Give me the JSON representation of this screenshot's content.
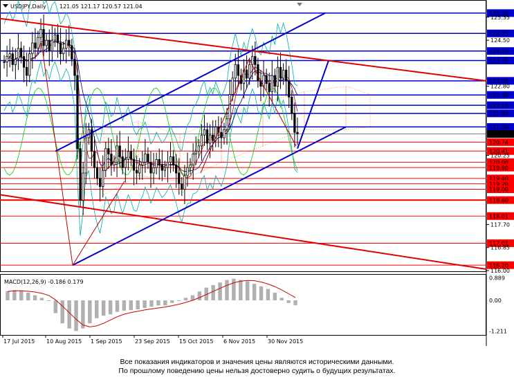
{
  "header": {
    "symbol": "USDJPY,Daily",
    "ohlc": "121.05 121.17 120.57 121.04"
  },
  "macd": {
    "label": "MACD(12,26,9) -0.186 0.179",
    "ticks": [
      "0.889",
      "0.00",
      "-1.211"
    ],
    "ylim": [
      -1.3,
      0.95
    ]
  },
  "disclaimer": {
    "line1": "Все показания индикаторов и значения цены являются историческими данными.",
    "line2": "По прошлому поведению цены нельзя достоверно судить о будущих результатах."
  },
  "colors": {
    "level_line": "#ff0000",
    "level_label_bg": "#ff0000",
    "key_level_bg": "#0000cc",
    "channel_red": "#e00000",
    "channel_blue": "#0000cc",
    "candles": "#000000",
    "bands": "#00aaaa",
    "ichimoku_cloud": "#ff9966",
    "rsi_line": "#00cc00",
    "macd_hist": "#b0b0b0",
    "macd_signal": "#cc0000"
  },
  "chart_data": {
    "type": "candlestick",
    "symbol": "USDJPY",
    "timeframe": "Daily",
    "ylim": [
      116.0,
      125.6
    ],
    "x_labels": [
      "17 Jul 2015",
      "10 Aug 2015",
      "1 Sep 2015",
      "23 Sep 2015",
      "15 Oct 2015",
      "6 Nov 2015",
      "30 Nov 2015"
    ],
    "price_ticks": [
      "125.50",
      "125.35",
      "124.75",
      "124.50",
      "124.10",
      "123.75",
      "123.00",
      "122.80",
      "122.48",
      "122.10",
      "121.80",
      "121.30",
      "121.04",
      "120.74",
      "120.41",
      "120.25",
      "120.00",
      "119.80",
      "119.40",
      "119.20",
      "119.00",
      "118.60",
      "118.01",
      "117.70",
      "117.01",
      "116.85",
      "116.20",
      "116.00"
    ],
    "levels": [
      {
        "price": "125.50",
        "style": "key"
      },
      {
        "price": "124.75",
        "style": "key"
      },
      {
        "price": "124.10",
        "style": "key"
      },
      {
        "price": "123.75",
        "style": "key"
      },
      {
        "price": "123.00",
        "style": "key"
      },
      {
        "price": "122.48",
        "style": "key"
      },
      {
        "price": "122.10",
        "style": "key"
      },
      {
        "price": "121.80",
        "style": "key"
      },
      {
        "price": "121.30",
        "style": "key"
      },
      {
        "price": "121.04",
        "style": "current"
      },
      {
        "price": "120.74",
        "style": "support"
      },
      {
        "price": "120.41",
        "style": "support"
      },
      {
        "price": "120.00",
        "style": "support"
      },
      {
        "price": "119.80",
        "style": "support"
      },
      {
        "price": "119.40",
        "style": "support"
      },
      {
        "price": "119.20",
        "style": "support"
      },
      {
        "price": "119.00",
        "style": "support"
      },
      {
        "price": "118.60",
        "style": "support"
      },
      {
        "price": "118.01",
        "style": "line"
      },
      {
        "price": "117.01",
        "style": "line"
      },
      {
        "price": "116.20",
        "style": "line"
      }
    ],
    "series": [
      {
        "close": [
          123.7,
          123.9,
          124.0,
          123.6,
          123.8,
          124.2,
          123.9,
          123.5,
          123.2,
          124.0,
          124.4,
          124.2,
          124.6,
          124.9,
          124.3,
          124.5,
          124.1,
          124.5,
          124.7,
          124.4,
          124.0,
          124.2,
          124.5,
          124.3,
          123.8,
          123.2,
          120.5,
          118.6,
          119.6,
          120.9,
          121.2,
          120.4,
          119.8,
          119.4,
          119.1,
          119.7,
          120.5,
          120.3,
          119.9,
          120.0,
          120.6,
          120.2,
          119.8,
          120.1,
          120.4,
          120.1,
          119.7,
          119.6,
          119.9,
          120.0,
          120.3,
          120.0,
          119.6,
          119.8,
          120.1,
          119.9,
          119.7,
          119.8,
          120.0,
          120.2,
          119.9,
          119.6,
          119.2,
          119.0,
          119.5,
          119.8,
          119.9,
          120.3,
          120.4,
          120.6,
          121.0,
          121.2,
          120.7,
          121.0,
          120.8,
          121.3,
          121.1,
          120.9,
          121.2,
          121.6,
          122.5,
          123.1,
          123.6,
          123.2,
          122.9,
          123.4,
          123.1,
          123.6,
          123.9,
          123.6,
          123.0,
          122.8,
          123.2,
          122.9,
          122.6,
          123.2,
          122.8,
          123.5,
          123.1,
          123.4,
          123.0,
          122.4,
          121.8,
          121.1,
          121.04
        ]
      },
      {
        "macd_histogram_approx": [
          0.35,
          0.4,
          0.38,
          0.3,
          0.2,
          0.1,
          0.0,
          -0.5,
          -0.9,
          -1.1,
          -1.2,
          -1.1,
          -0.9,
          -0.7,
          -0.6,
          -0.55,
          -0.45,
          -0.4,
          -0.38,
          -0.35,
          -0.3,
          -0.25,
          -0.2,
          -0.2,
          -0.1,
          0.0,
          0.1,
          0.2,
          0.35,
          0.5,
          0.6,
          0.7,
          0.8,
          0.85,
          0.8,
          0.75,
          0.65,
          0.55,
          0.45,
          0.3,
          0.1,
          -0.1,
          -0.186
        ]
      }
    ]
  }
}
